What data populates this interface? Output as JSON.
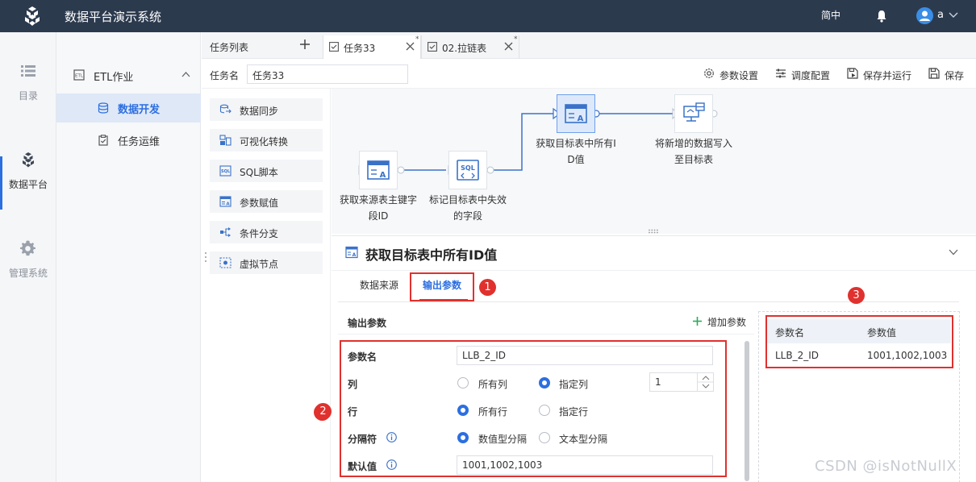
{
  "header": {
    "app_title": "数据平台演示系统",
    "language": "简中",
    "user_name": "a"
  },
  "rail": {
    "items": [
      {
        "label": "目录",
        "icon": "list-icon"
      },
      {
        "label": "数据平台",
        "icon": "cubes-icon",
        "active": true
      },
      {
        "label": "管理系统",
        "icon": "gear-icon"
      }
    ]
  },
  "nav": {
    "group_label": "ETL作业",
    "items": [
      {
        "label": "数据开发",
        "icon": "database-icon",
        "active": true
      },
      {
        "label": "任务运维",
        "icon": "clipboard-icon"
      }
    ]
  },
  "tabs": {
    "list_label": "任务列表",
    "items": [
      {
        "label": "任务33",
        "active": true,
        "modified_mark": "*"
      },
      {
        "label": "02.拉链表",
        "active": false,
        "modified_mark": "*"
      }
    ]
  },
  "toolbar": {
    "task_name_label": "任务名",
    "task_name_value": "任务33",
    "buttons": [
      {
        "label": "参数设置",
        "icon": "gear-icon"
      },
      {
        "label": "调度配置",
        "icon": "sliders-icon"
      },
      {
        "label": "保存并运行",
        "icon": "save-run-icon"
      },
      {
        "label": "保存",
        "icon": "save-icon"
      }
    ]
  },
  "palette": {
    "items": [
      {
        "label": "数据同步",
        "icon": "sync-icon"
      },
      {
        "label": "可视化转换",
        "icon": "transform-icon"
      },
      {
        "label": "SQL脚本",
        "icon": "sql-icon"
      },
      {
        "label": "参数赋值",
        "icon": "param-assign-icon"
      },
      {
        "label": "条件分支",
        "icon": "branch-icon"
      },
      {
        "label": "虚拟节点",
        "icon": "virtual-node-icon"
      }
    ]
  },
  "flow": {
    "nodes": [
      {
        "label_line1": "获取来源表主键字",
        "label_line2": "段ID",
        "icon": "param-assign-icon"
      },
      {
        "label_line1": "标记目标表中失效",
        "label_line2": "的字段",
        "icon": "sql-icon",
        "icon_text": "SQL"
      },
      {
        "label_line1": "获取目标表中所有I",
        "label_line2": "D值",
        "icon": "param-assign-icon",
        "selected": true
      },
      {
        "label_line1": "将新增的数据写入",
        "label_line2": "至目标表",
        "icon": "sync-icon"
      }
    ]
  },
  "detail": {
    "title": "获取目标表中所有ID值",
    "subtabs": [
      {
        "label": "数据来源",
        "active": false
      },
      {
        "label": "输出参数",
        "active": true
      }
    ],
    "badges": [
      "1",
      "2",
      "3"
    ],
    "output_params_label": "输出参数",
    "add_param_label": "增加参数",
    "form": {
      "param_name_label": "参数名",
      "param_name_value": "LLB_2_ID",
      "column_label": "列",
      "column_options": [
        "所有列",
        "指定列"
      ],
      "column_selected": "指定列",
      "column_index": "1",
      "row_label": "行",
      "row_options": [
        "所有行",
        "指定行"
      ],
      "row_selected": "所有行",
      "separator_label": "分隔符",
      "separator_options": [
        "数值型分隔",
        "文本型分隔"
      ],
      "separator_selected": "数值型分隔",
      "default_label": "默认值",
      "default_value": "1001,1002,1003"
    },
    "table": {
      "headers": [
        "参数名",
        "参数值"
      ],
      "rows": [
        [
          "LLB_2_ID",
          "1001,1002,1003"
        ]
      ]
    }
  },
  "watermark": "CSDN @isNotNullX",
  "colors": {
    "topbar": "#2c3a4e",
    "accent": "#2c6fe0",
    "annotation_red": "#e0312e",
    "selected_node": "#dde9fb"
  }
}
